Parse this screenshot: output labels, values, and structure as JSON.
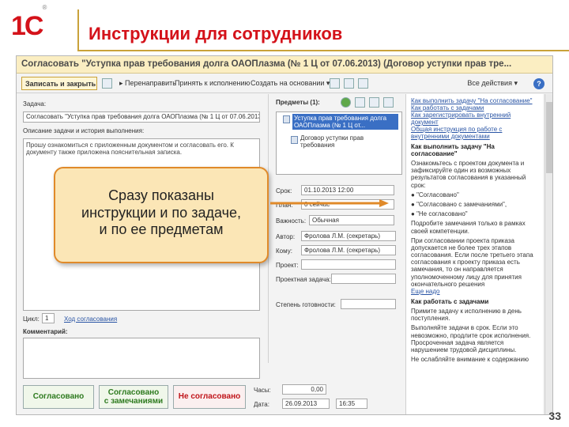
{
  "slide": {
    "logo": "1С",
    "title": "Инструкции для сотрудников",
    "page_number": "33"
  },
  "window": {
    "title": "Согласовать \"Уступка прав требования долга ОАОПлазма (№ 1 Ц от 07.06.2013) (Договор уступки прав тре...",
    "toolbar": {
      "save_close": "Записать и закрыть",
      "forward": "Перенаправить",
      "accept": "Принять к исполнению",
      "create_based": "Создать на основании",
      "more": "Все действия"
    }
  },
  "task": {
    "label": "Задача:",
    "value": "Согласовать \"Уступка прав требования долга ОАОПлазма (№ 1 Ц от 07.06.2013)",
    "desc_label": "Описание задачи и история выполнения:",
    "desc_text": "Прошу ознакомиться с приложенным документом и согласовать его. К документу также приложена пояснительная записка.",
    "cycle_label": "Цикл:",
    "cycle_value": "1",
    "history_link": "Ход согласования",
    "comment_label": "Комментарий:"
  },
  "subjects": {
    "label": "Предметы (1):",
    "item1": "Уступка прав требования долга ОАОПлазма (№ 1 Ц от...",
    "item2": "Договор уступки прав требования"
  },
  "fields": {
    "due_label": "Срок:",
    "due_value": "01.10.2013 12:00",
    "plan_label": "План:",
    "plan_value": "0 сейчас",
    "importance_label": "Важность:",
    "importance_value": "Обычная",
    "author_label": "Автор:",
    "author_value": "Фролова Л.М. (секретарь)",
    "to_label": "Кому:",
    "to_value": "Фролова Л.М. (секретарь)",
    "project_label": "Проект:",
    "project_task_label": "Проектная задача:",
    "progress_label": "Степень готовности:"
  },
  "bottom": {
    "approved": "Согласовано",
    "approved_remarks_1": "Согласовано",
    "approved_remarks_2": "с замечаниями",
    "not_approved": "Не согласовано",
    "hours_label": "Часы:",
    "hours_value": "0,00",
    "date_label": "Дата:",
    "date_value": "26.09.2013",
    "time_value": "16:35"
  },
  "help": {
    "link1": "Как выполнить задачу \"На согласование\"",
    "link2": "Как работать с задачами",
    "link3": "Как зарегистрировать внутренний документ",
    "link4": "Общая инструкция по работе с внутренними документами",
    "heading1": "Как выполнить задачу \"На согласование\"",
    "p1": "Ознакомьтесь с проектом документа и зафиксируйте один из возможных результатов согласования в указанный срок:",
    "b1": "\"Согласовано\"",
    "b2": "\"Согласовано с замечаниями\",",
    "b3": "\"Не согласовано\"",
    "p2": "Подробите замечания только в рамках своей компетенции.",
    "p3": "При согласовании проекта приказа допускается не более трех этапов согласования. Если после третьего этапа согласования к проекту приказа есть замечания, то он направляется уполномоченному лицу для принятия окончательного решения",
    "more1": "Еще надо",
    "heading2": "Как работать с задачами",
    "p4": "Примите задачу к исполнению в день поступления.",
    "p5": "Выполняйте задачи в срок. Если это невозможно, продлите срок исполнения. Просроченная задача является нарушением трудовой дисциплины.",
    "p6": "Не ослабляйте внимание к содержанию"
  },
  "callout": {
    "line1": "Сразу показаны",
    "line2": "инструкции и по задаче,",
    "line3": "и по ее предметам"
  },
  "colors": {
    "brand_red": "#d4121a",
    "accent_gold": "#c9a23a",
    "callout_bg": "#fbe6b6",
    "callout_border": "#e08a2a"
  }
}
